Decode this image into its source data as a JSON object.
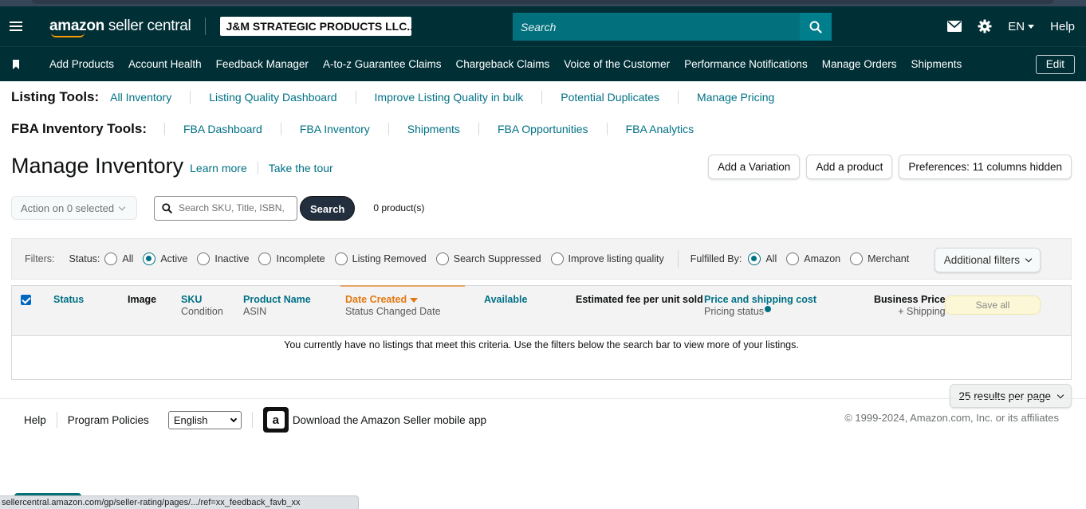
{
  "header": {
    "logo_bold": "amazon",
    "logo_rest": " seller central",
    "account_name": "J&M STRATEGIC PRODUCTS LLC...",
    "search_placeholder": "Search",
    "language": "EN",
    "help": "Help"
  },
  "nav": {
    "items": [
      "Add Products",
      "Account Health",
      "Feedback Manager",
      "A-to-z Guarantee Claims",
      "Chargeback Claims",
      "Voice of the Customer",
      "Performance Notifications",
      "Manage Orders",
      "Shipments"
    ],
    "edit": "Edit"
  },
  "listing_tools": {
    "label": "Listing Tools:",
    "links": [
      "All Inventory",
      "Listing Quality Dashboard",
      "Improve Listing Quality in bulk",
      "Potential Duplicates",
      "Manage Pricing"
    ]
  },
  "fba_tools": {
    "label": "FBA Inventory Tools:",
    "links": [
      "FBA Dashboard",
      "FBA Inventory",
      "Shipments",
      "FBA Opportunities",
      "FBA Analytics"
    ]
  },
  "page": {
    "title": "Manage Inventory",
    "learn_more": "Learn more",
    "take_tour": "Take the tour",
    "buttons": [
      "Add a Variation",
      "Add a product",
      "Preferences: 11 columns hidden"
    ]
  },
  "actions": {
    "action_select": "Action on 0 selected",
    "search_placeholder": "Search SKU, Title, ISBN,",
    "search_button": "Search",
    "product_count": "0 product(s)"
  },
  "filters": {
    "label": "Filters:",
    "status_label": "Status:",
    "status_options": [
      "All",
      "Active",
      "Inactive",
      "Incomplete",
      "Listing Removed",
      "Search Suppressed",
      "Improve listing quality"
    ],
    "status_selected": "Active",
    "fulfilled_label": "Fulfilled By:",
    "fulfilled_options": [
      "All",
      "Amazon",
      "Merchant"
    ],
    "fulfilled_selected": "All",
    "additional": "Additional filters"
  },
  "table": {
    "columns": {
      "status": "Status",
      "image": "Image",
      "sku": "SKU",
      "condition": "Condition",
      "product_name": "Product Name",
      "asin": "ASIN",
      "date_created": "Date Created",
      "status_changed": "Status Changed Date",
      "available": "Available",
      "fee": "Estimated fee per unit sold",
      "price": "Price and shipping cost",
      "pricing_status": "Pricing status",
      "business_price": "Business Price",
      "plus_shipping": "+ Shipping"
    },
    "save_all": "Save all",
    "empty_message": "You currently have no listings that meet this criteria. Use the filters below the search bar to view more of your listings."
  },
  "pagination": {
    "per_page": "25 results per page"
  },
  "footer": {
    "help": "Help",
    "policies": "Program Policies",
    "language_select": "English",
    "app_link": "Download the Amazon Seller mobile app",
    "copyright": "© 1999-2024, Amazon.com, Inc. or its affiliates"
  },
  "statusbar": {
    "url": "sellercentral.amazon.com/gp/seller-rating/pages/.../ref=xx_feedback_favb_xx"
  },
  "colors": {
    "header_bg": "#002f36",
    "search_bg": "#02707d",
    "link": "#007185",
    "sort_accent": "#e47911"
  }
}
